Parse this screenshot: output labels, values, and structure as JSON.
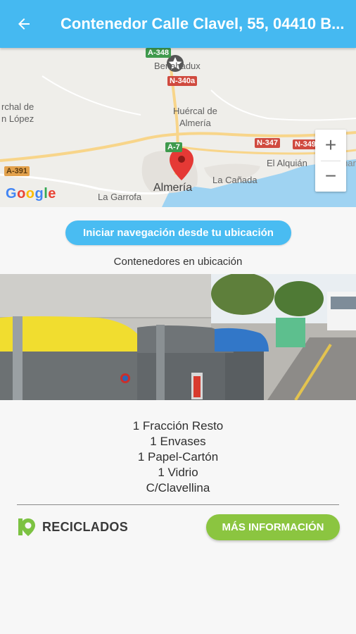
{
  "appbar": {
    "title": "Contenedor Calle Clavel, 55, 04410 B..."
  },
  "map": {
    "labels": {
      "benahadux": "Benahadux",
      "huercal_line1": "Huércal de",
      "huercal_line2": "Almería",
      "almeria": "Almería",
      "la_canada": "La Cañada",
      "el_alquian": "El Alquián",
      "retamar": "Retamar",
      "la_garrofa": "La Garrofa",
      "orchal_line1": "rchal de",
      "orchal_line2": "n López"
    },
    "roads": {
      "a348": "A-348",
      "n340a": "N-340a",
      "n347": "N-347",
      "n349": "N-349",
      "a391": "A-391",
      "a7": "A-7"
    },
    "zoom_in": "+",
    "zoom_out": "−",
    "provider": "Google",
    "colors": {
      "pin": "#e53935",
      "sea": "#9fd3f2",
      "road": "#f8d58a"
    }
  },
  "navigation_button": "Iniciar navegación desde tu ubicación",
  "containers_caption": "Contenedores en ubicación",
  "container_details": [
    "1 Fracción Resto",
    "1 Envases",
    "1 Papel-Cartón",
    "1 Vidrio",
    "C/Clavellina"
  ],
  "brand": {
    "name": "RECICLADOS",
    "color": "#7cc242"
  },
  "more_info_button": "MÁS INFORMACIÓN",
  "colors": {
    "appbar": "#45b9f1",
    "more_info": "#8bc540"
  }
}
